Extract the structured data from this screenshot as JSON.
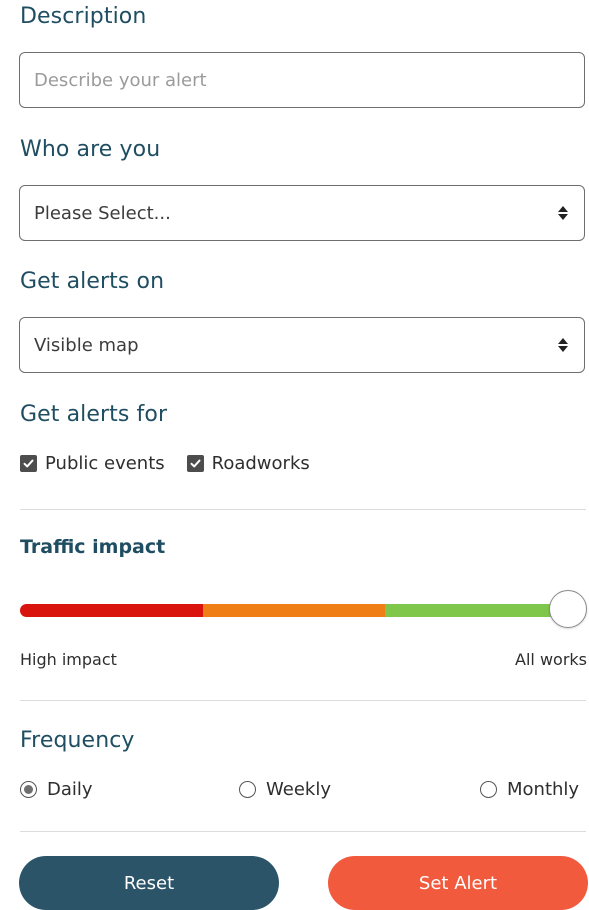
{
  "description": {
    "heading": "Description",
    "placeholder": "Describe your alert"
  },
  "who": {
    "heading": "Who are you",
    "selected": "Please Select..."
  },
  "alerts_on": {
    "heading": "Get alerts on",
    "selected": "Visible map"
  },
  "alerts_for": {
    "heading": "Get alerts for",
    "options": [
      {
        "label": "Public events",
        "checked": true
      },
      {
        "label": "Roadworks",
        "checked": true
      }
    ]
  },
  "traffic": {
    "heading": "Traffic impact",
    "low_label": "High impact",
    "high_label": "All works",
    "level": 1.0,
    "colors": [
      "#d9140f",
      "#ef7e16",
      "#7fc74a"
    ]
  },
  "frequency": {
    "heading": "Frequency",
    "options": [
      {
        "label": "Daily",
        "selected": true
      },
      {
        "label": "Weekly",
        "selected": false
      },
      {
        "label": "Monthly",
        "selected": false
      }
    ]
  },
  "actions": {
    "reset_label": "Reset",
    "set_label": "Set Alert",
    "reset_color": "#2b5468",
    "set_color": "#f25a3e"
  },
  "colors": {
    "heading": "#1f4d61"
  }
}
